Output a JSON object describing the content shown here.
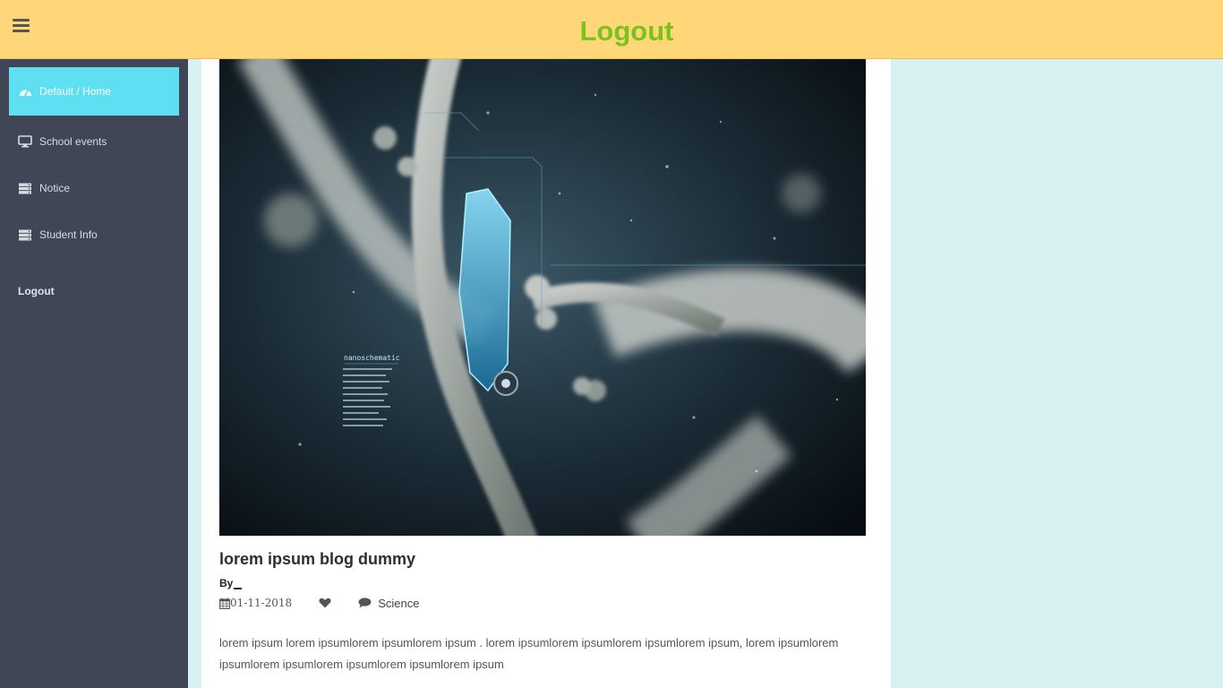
{
  "header": {
    "title": "Logout",
    "menu_icon": "hamburger-icon"
  },
  "sidebar": {
    "items": [
      {
        "label": "Default / Home",
        "icon": "dashboard-icon",
        "active": true
      },
      {
        "label": "School events",
        "icon": "monitor-icon",
        "active": false
      },
      {
        "label": "Notice",
        "icon": "server-icon",
        "active": false
      },
      {
        "label": "Student Info",
        "icon": "server-icon",
        "active": false
      }
    ],
    "logout_label": "Logout"
  },
  "post": {
    "image_text": "nanoschematic",
    "title": "lorem ipsum blog dummy",
    "by_label": "By",
    "date": "01-11-2018",
    "category": "Science",
    "body": "lorem ipsum lorem ipsumlorem ipsumlorem ipsum . lorem ipsumlorem ipsumlorem ipsumlorem ipsum, lorem ipsumlorem ipsumlorem ipsumlorem ipsumlorem ipsumlorem ipsum"
  },
  "colors": {
    "header_bg": "#ffd778",
    "header_title": "#7ac21e",
    "sidebar_bg": "#404656",
    "active_item_bg": "#5fdff2",
    "page_bg": "#d8f1f2"
  }
}
